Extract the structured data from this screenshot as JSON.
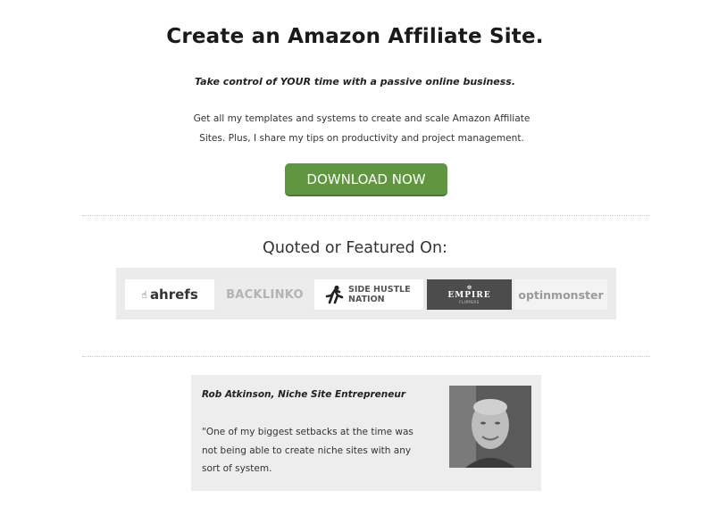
{
  "hero": {
    "title": "Create an Amazon Affiliate Site.",
    "tagline": "Take control of YOUR time with a passive online business.",
    "description": "Get all my templates and systems to create and scale Amazon Affiliate Sites. Plus, I share my tips on productivity and project management.",
    "cta_label": "DOWNLOAD NOW",
    "cta_color": "#5f963f"
  },
  "featured": {
    "heading": "Quoted or Featured On:",
    "logos": [
      {
        "name": "ahrefs",
        "text": "ahrefs",
        "icon": "hand-pointer-icon"
      },
      {
        "name": "backlinko",
        "text": "BACKLINKO"
      },
      {
        "name": "side-hustle-nation",
        "line1": "SIDE HUSTLE",
        "line2": "NATION",
        "icon": "running-figure-icon"
      },
      {
        "name": "empire-flippers",
        "text": "EMPIRE",
        "sub": "FLIPPERS",
        "icon": "crown-icon"
      },
      {
        "name": "optinmonster",
        "text": "optinmonster"
      }
    ]
  },
  "testimonial": {
    "name": "Rob Atkinson, Niche Site Entrepreneur",
    "quote": "\"One of my biggest setbacks at the time was not being able to create niche sites with any sort of system."
  }
}
